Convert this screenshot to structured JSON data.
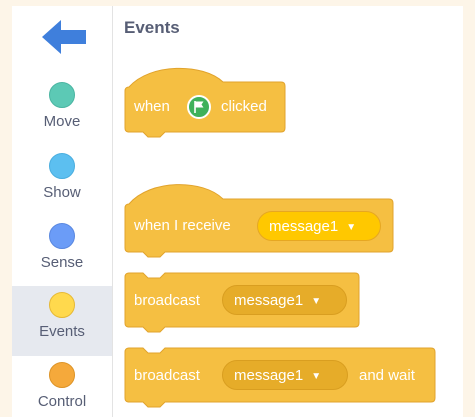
{
  "sidebar": {
    "back_icon": "back-arrow-icon",
    "categories": [
      {
        "label": "Move",
        "color": "#5cc9b5"
      },
      {
        "label": "Show",
        "color": "#5cbff0"
      },
      {
        "label": "Sense",
        "color": "#6b9cf7"
      },
      {
        "label": "Events",
        "color": "#ffd94d",
        "selected": true
      },
      {
        "label": "Control",
        "color": "#f5a93b"
      }
    ]
  },
  "palette": {
    "title": "Events",
    "blocks": {
      "when_flag_clicked": {
        "before": "when",
        "icon": "green-flag-icon",
        "after": "clicked"
      },
      "when_i_receive": {
        "text": "when I receive",
        "dropdown": "message1"
      },
      "broadcast": {
        "text": "broadcast",
        "dropdown": "message1"
      },
      "broadcast_and_wait": {
        "text": "broadcast",
        "dropdown": "message1",
        "after": "and wait"
      }
    }
  },
  "colors": {
    "events_block": "#f5bf42",
    "events_block_border": "#e1a32c",
    "back_arrow": "#3f7fdc",
    "text": "#575e75"
  }
}
